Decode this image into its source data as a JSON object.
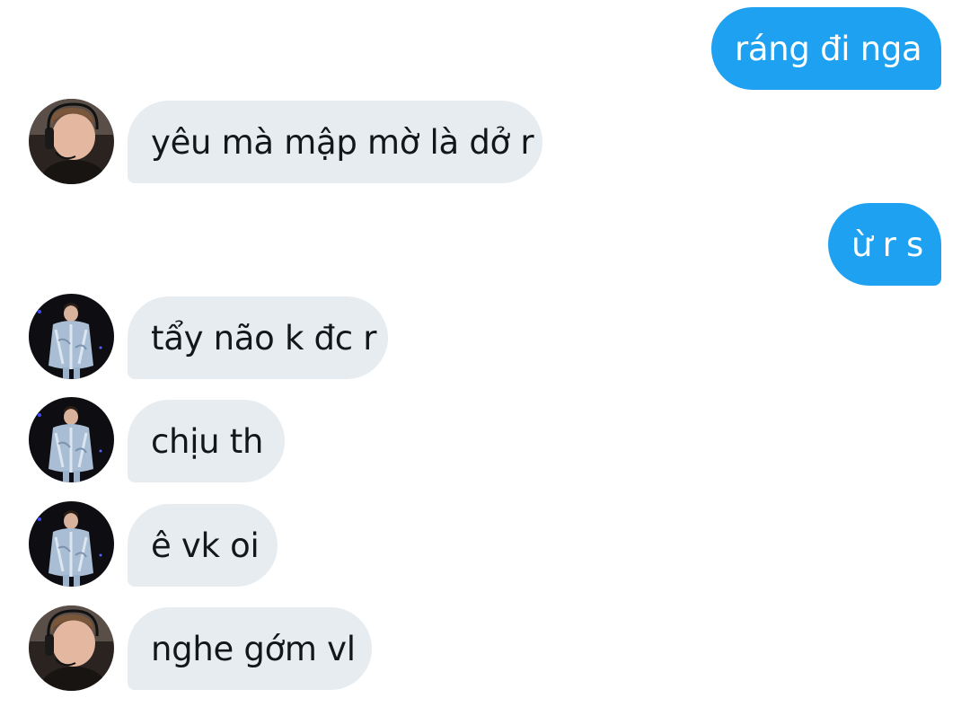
{
  "conversation": {
    "messages": [
      {
        "sender": "me",
        "text": "ráng đi nga"
      },
      {
        "sender": "them",
        "text": "yêu mà mập mờ là dở r",
        "avatar": "headset-portrait"
      },
      {
        "sender": "me",
        "text": "ừ r s"
      },
      {
        "sender": "them",
        "text": "tẩy não k đc r",
        "avatar": "denim-jacket-portrait"
      },
      {
        "sender": "them",
        "text": "chịu th",
        "avatar": "denim-jacket-portrait"
      },
      {
        "sender": "them",
        "text": "ê vk oi",
        "avatar": "denim-jacket-portrait"
      },
      {
        "sender": "them",
        "text": "nghe gớm vl",
        "avatar": "headset-portrait"
      }
    ]
  },
  "colors": {
    "outgoing_bubble": "#1ea1f1",
    "incoming_bubble": "#e6ecf0",
    "outgoing_text": "#ffffff",
    "incoming_text": "#14171a"
  }
}
